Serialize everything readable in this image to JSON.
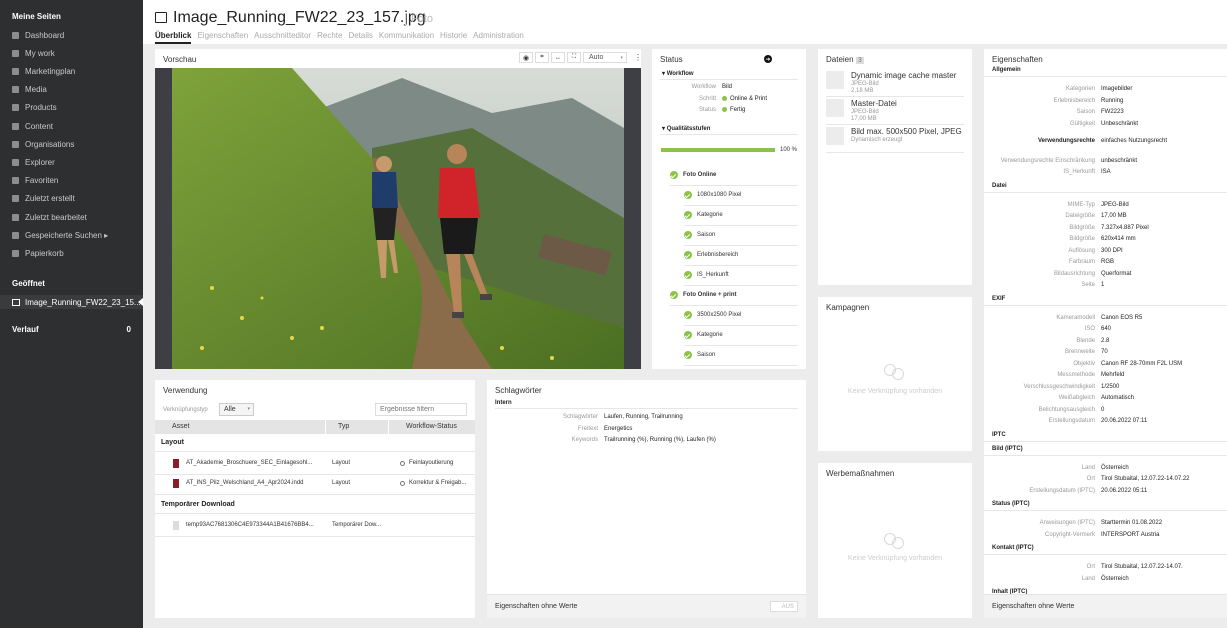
{
  "sidebar": {
    "heading": "Meine Seiten",
    "items": [
      {
        "label": "Dashboard",
        "icon": "home-icon"
      },
      {
        "label": "My work",
        "icon": "briefcase-icon"
      },
      {
        "label": "Marketingplan",
        "icon": "chart-icon"
      },
      {
        "label": "Media",
        "icon": "image-icon"
      },
      {
        "label": "Products",
        "icon": "box-icon"
      },
      {
        "label": "Content",
        "icon": "document-icon"
      },
      {
        "label": "Organisations",
        "icon": "globe-icon"
      },
      {
        "label": "Explorer",
        "icon": "compass-icon"
      },
      {
        "label": "Favoriten",
        "icon": "heart-icon"
      },
      {
        "label": "Zuletzt erstellt",
        "icon": "clock-icon"
      },
      {
        "label": "Zuletzt bearbeitet",
        "icon": "edit-icon"
      },
      {
        "label": "Gespeicherte Suchen ▸",
        "icon": "search-icon"
      },
      {
        "label": "Papierkorb",
        "icon": "trash-icon"
      }
    ],
    "open_heading": "Geöffnet",
    "open_item": "Image_Running_FW22_23_15...",
    "history_heading": "Verlauf",
    "history_count": "0"
  },
  "header": {
    "title": "Image_Running_FW22_23_157.jpg",
    "subtitle": "Foto",
    "tabs": [
      "Überblick",
      "Eigenschaften",
      "Ausschnitteditor",
      "Rechte",
      "Details",
      "Kommunikation",
      "Historie",
      "Administration"
    ]
  },
  "preview": {
    "title": "Vorschau",
    "zoom": "Auto"
  },
  "status": {
    "title": "Status",
    "workflow_heading": "Workflow",
    "workflow": [
      {
        "label": "Workflow",
        "value": "Bild"
      },
      {
        "label": "Schritt",
        "value": "Online & Print"
      },
      {
        "label": "Status",
        "value": "Fertig"
      }
    ],
    "quality_heading": "Qualitätsstufen",
    "progress_pct": "100 %",
    "progress_fraction": 1.0,
    "checks": [
      {
        "label": "Foto Online",
        "bold": true
      },
      {
        "label": "1080x1080 Pixel",
        "bold": false
      },
      {
        "label": "Kategorie",
        "bold": false
      },
      {
        "label": "Saison",
        "bold": false
      },
      {
        "label": "Erlebnisbereich",
        "bold": false
      },
      {
        "label": "IS_Herkunft",
        "bold": false
      },
      {
        "label": "Foto Online + print",
        "bold": true
      },
      {
        "label": "3500x2500 Pixel",
        "bold": false
      },
      {
        "label": "Kategorie",
        "bold": false
      },
      {
        "label": "Saison",
        "bold": false
      }
    ]
  },
  "files": {
    "title": "Dateien",
    "count": "3",
    "items": [
      {
        "name": "Dynamic image cache master",
        "type": "JPEG-Bild",
        "size": "2,18 MB"
      },
      {
        "name": "Master-Datei",
        "type": "JPEG-Bild",
        "size": "17,00 MB"
      },
      {
        "name": "Bild max. 500x500 Pixel, JPEG",
        "type": "Dynamisch erzeugt",
        "size": ""
      }
    ]
  },
  "campaigns": {
    "title": "Kampagnen",
    "empty": "Keine Verknüpfung vorhanden"
  },
  "measures": {
    "title": "Werbemaßnahmen",
    "empty": "Keine Verknüpfung vorhanden"
  },
  "usage": {
    "title": "Verwendung",
    "filter_label": "Verknüpfungstyp",
    "filter_value": "Alle",
    "search_placeholder": "Ergebnisse filtern",
    "columns": [
      "Asset",
      "Typ",
      "Workflow-Status"
    ],
    "groups": [
      {
        "heading": "Layout",
        "rows": [
          {
            "asset": "AT_Akademie_Broschuere_SEC_Einlagesohl...",
            "type": "Layout",
            "status": "Feinlayoutierung"
          },
          {
            "asset": "AT_INS_Pilz_Welschland_A4_Apr2024.indd",
            "type": "Layout",
            "status": "Korrektur & Freigab..."
          }
        ]
      },
      {
        "heading": "Temporärer Download",
        "rows": [
          {
            "asset": "temp93AC7681306C4E973344A1B41676BB4...",
            "type": "Temporärer Dow...",
            "status": ""
          }
        ]
      }
    ]
  },
  "keywords": {
    "title": "Schlagwörter",
    "section": "Intern",
    "rows": [
      {
        "label": "Schlagwörter",
        "value": "Laufen, Running, Trailrunning"
      },
      {
        "label": "Freitext",
        "value": "Energetics"
      },
      {
        "label": "Keywords",
        "value": "Trailrunning (%), Running (%), Laufen (%)"
      }
    ],
    "footer": "Eigenschaften ohne Werte",
    "toggle": "AUS"
  },
  "properties": {
    "title": "Eigenschaften",
    "footer": "Eigenschaften ohne Werte",
    "sections": [
      {
        "heading": "Allgemein",
        "rows": [
          {
            "label": "Kategorien",
            "value": "Imagebilder"
          },
          {
            "label": "Erlebnisbereich",
            "value": "Running"
          },
          {
            "label": "Saison",
            "value": "FW2223"
          },
          {
            "label": "Gültigkeit",
            "value": "Unbeschränkt"
          },
          {
            "label": "Verwendungsrechte",
            "value": "einfaches Nutzungsrecht"
          },
          {
            "label": "Verwendungsrechte Einschränkung",
            "value": "unbeschränkt"
          },
          {
            "label": "IS_Herkunft",
            "value": "ISA"
          }
        ]
      },
      {
        "heading": "Datei",
        "rows": [
          {
            "label": "MIME-Typ",
            "value": "JPEG-Bild"
          },
          {
            "label": "Dateigröße",
            "value": "17,00 MB"
          },
          {
            "label": "Bildgröße",
            "value": "7.327x4.887 Pixel"
          },
          {
            "label": "Bildgröße",
            "value": "620x414 mm"
          },
          {
            "label": "Auflösung",
            "value": "300 DPI"
          },
          {
            "label": "Farbraum",
            "value": "RGB"
          },
          {
            "label": "Bildausrichtung",
            "value": "Querformat"
          },
          {
            "label": "Seite",
            "value": "1"
          }
        ]
      },
      {
        "heading": "EXIF",
        "rows": [
          {
            "label": "Kameramodell",
            "value": "Canon EOS R5"
          },
          {
            "label": "ISO",
            "value": "640"
          },
          {
            "label": "Blende",
            "value": "2.8"
          },
          {
            "label": "Brennweite",
            "value": "70"
          },
          {
            "label": "Objektiv",
            "value": "Canon RF 28-70mm F2L USM"
          },
          {
            "label": "Messmethode",
            "value": "Mehrfeld"
          },
          {
            "label": "Verschlussgeschwindigkeit",
            "value": "1/2500"
          },
          {
            "label": "Weißabgleich",
            "value": "Automatisch"
          },
          {
            "label": "Belichtungsausgleich",
            "value": "0"
          },
          {
            "label": "Erstellungsdatum",
            "value": "20.06.2022 07:11"
          }
        ]
      },
      {
        "heading": "IPTC",
        "rows": []
      },
      {
        "heading": "Bild (IPTC)",
        "rows": [
          {
            "label": "Land",
            "value": "Österreich"
          },
          {
            "label": "Ort",
            "value": "Tirol Stubaital, 12.07.22-14.07.22"
          },
          {
            "label": "Erstellungsdatum (IPTC)",
            "value": "20.06.2022 05:11"
          }
        ]
      },
      {
        "heading": "Status (IPTC)",
        "rows": [
          {
            "label": "Anweisungen (IPTC)",
            "value": "Starttermin 01.08.2022"
          },
          {
            "label": "Copyright-Vermerk",
            "value": "INTERSPORT Austria"
          }
        ]
      },
      {
        "heading": "Kontakt (IPTC)",
        "rows": [
          {
            "label": "Ort",
            "value": "Tirol Stubaital, 12.07.22-14.07."
          },
          {
            "label": "Land",
            "value": "Österreich"
          }
        ]
      },
      {
        "heading": "Inhalt (IPTC)",
        "rows": []
      }
    ]
  },
  "colors": {
    "accent": "#8bc34a",
    "sidebar": "#2e2f31"
  }
}
